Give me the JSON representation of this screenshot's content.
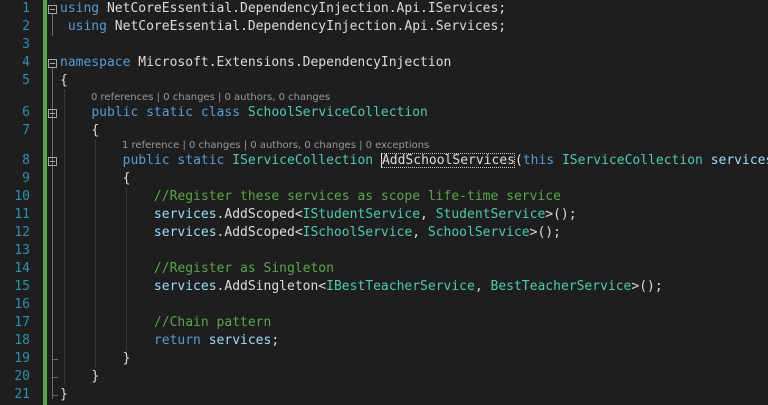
{
  "gutter": {
    "line_numbers": [
      "1",
      "2",
      "3",
      "4",
      "5",
      "6",
      "7",
      "8",
      "9",
      "10",
      "11",
      "12",
      "13",
      "14",
      "15",
      "16",
      "17",
      "18",
      "19",
      "20",
      "21"
    ]
  },
  "codelens": {
    "class_lens": "0 references | 0 changes | 0 authors, 0 changes",
    "method_lens": "1 reference | 0 changes | 0 authors, 0 changes | 0 exceptions"
  },
  "code": {
    "line1": {
      "using": "using",
      "ns": " NetCoreEssential.DependencyInjection.Api.IServices;"
    },
    "line2": {
      "using": "using",
      "ns": " NetCoreEssential.DependencyInjection.Api.Services;"
    },
    "line4": {
      "namespace": "namespace",
      "name": " Microsoft.Extensions.DependencyInjection"
    },
    "line5": "{",
    "line6": {
      "public": "public",
      "static": "static",
      "class": "class",
      "name": "SchoolServiceCollection"
    },
    "line7": "{",
    "line8": {
      "public": "public",
      "static": "static",
      "return_type": "IServiceCollection",
      "method": "AddSchoolServices",
      "open": "(",
      "this": "this",
      "param_type": "IServiceCollection",
      "param": "services",
      "close": ")"
    },
    "line9": "{",
    "line10": "//Register these services as scope life-time service",
    "line11": {
      "obj": "services",
      "call": ".AddScoped<",
      "t1": "IStudentService",
      "sep": ", ",
      "t2": "StudentService",
      "end": ">();"
    },
    "line12": {
      "obj": "services",
      "call": ".AddScoped<",
      "t1": "ISchoolService",
      "sep": ", ",
      "t2": "SchoolService",
      "end": ">();"
    },
    "line14": "//Register as Singleton",
    "line15": {
      "obj": "services",
      "call": ".AddSingleton<",
      "t1": "IBestTeacherService",
      "sep": ", ",
      "t2": "BestTeacherService",
      "end": ">();"
    },
    "line17": "//Chain pattern",
    "line18": {
      "return": "return",
      "obj": "services",
      "end": ";"
    },
    "line19": "}",
    "line20": "}",
    "line21": "}"
  }
}
